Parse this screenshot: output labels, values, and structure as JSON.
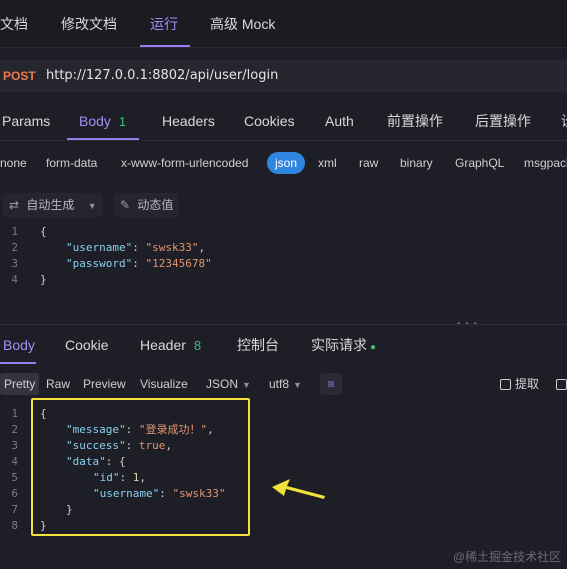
{
  "top_tabs": [
    {
      "label": "文档"
    },
    {
      "label": "修改文档"
    },
    {
      "label": "运行"
    },
    {
      "label": "高级 Mock"
    }
  ],
  "request": {
    "method": "POST",
    "url": "http://127.0.0.1:8802/api/user/login"
  },
  "request_tabs": [
    {
      "label": "Params"
    },
    {
      "label": "Body",
      "badge": "1"
    },
    {
      "label": "Headers"
    },
    {
      "label": "Cookies"
    },
    {
      "label": "Auth"
    },
    {
      "label": "前置操作"
    },
    {
      "label": "后置操作"
    },
    {
      "label": "设"
    }
  ],
  "body_types": [
    "none",
    "form-data",
    "x-www-form-urlencoded",
    "json",
    "xml",
    "raw",
    "binary",
    "GraphQL",
    "msgpack"
  ],
  "body_tools": {
    "auto_generate": "自动生成",
    "dynamic_value": "动态值"
  },
  "request_body": {
    "line_numbers": [
      "1",
      "2",
      "3",
      "4"
    ],
    "open": "{",
    "k1": "\"username\"",
    "v1": "\"swsk33\"",
    "k2": "\"password\"",
    "v2": "\"12345678\"",
    "close": "}"
  },
  "response_tabs": [
    {
      "label": "Body"
    },
    {
      "label": "Cookie"
    },
    {
      "label": "Header",
      "badge": "8"
    },
    {
      "label": "控制台"
    },
    {
      "label": "实际请求"
    }
  ],
  "response_formats": {
    "pretty": "Pretty",
    "raw": "Raw",
    "preview": "Preview",
    "visualize": "Visualize",
    "format": "JSON",
    "encoding": "utf8",
    "extract": "提取"
  },
  "response_body": {
    "line_numbers": [
      "1",
      "2",
      "3",
      "4",
      "5",
      "6",
      "7",
      "8"
    ],
    "open": "{",
    "k_message": "\"message\"",
    "v_message": "\"登录成功！\"",
    "k_success": "\"success\"",
    "v_success": "true",
    "k_data": "\"data\"",
    "k_id": "\"id\"",
    "v_id": "1",
    "k_username": "\"username\"",
    "v_username": "\"swsk33\"",
    "close": "}"
  },
  "watermark": "@稀土掘金技术社区",
  "colors": {
    "accent": "#9b7bf5",
    "method_post": "#f07a4a",
    "json_selected": "#2f86e0",
    "highlight": "#f2e13b",
    "arrow": "#f2e13b",
    "badge": "#3fbf6e"
  }
}
